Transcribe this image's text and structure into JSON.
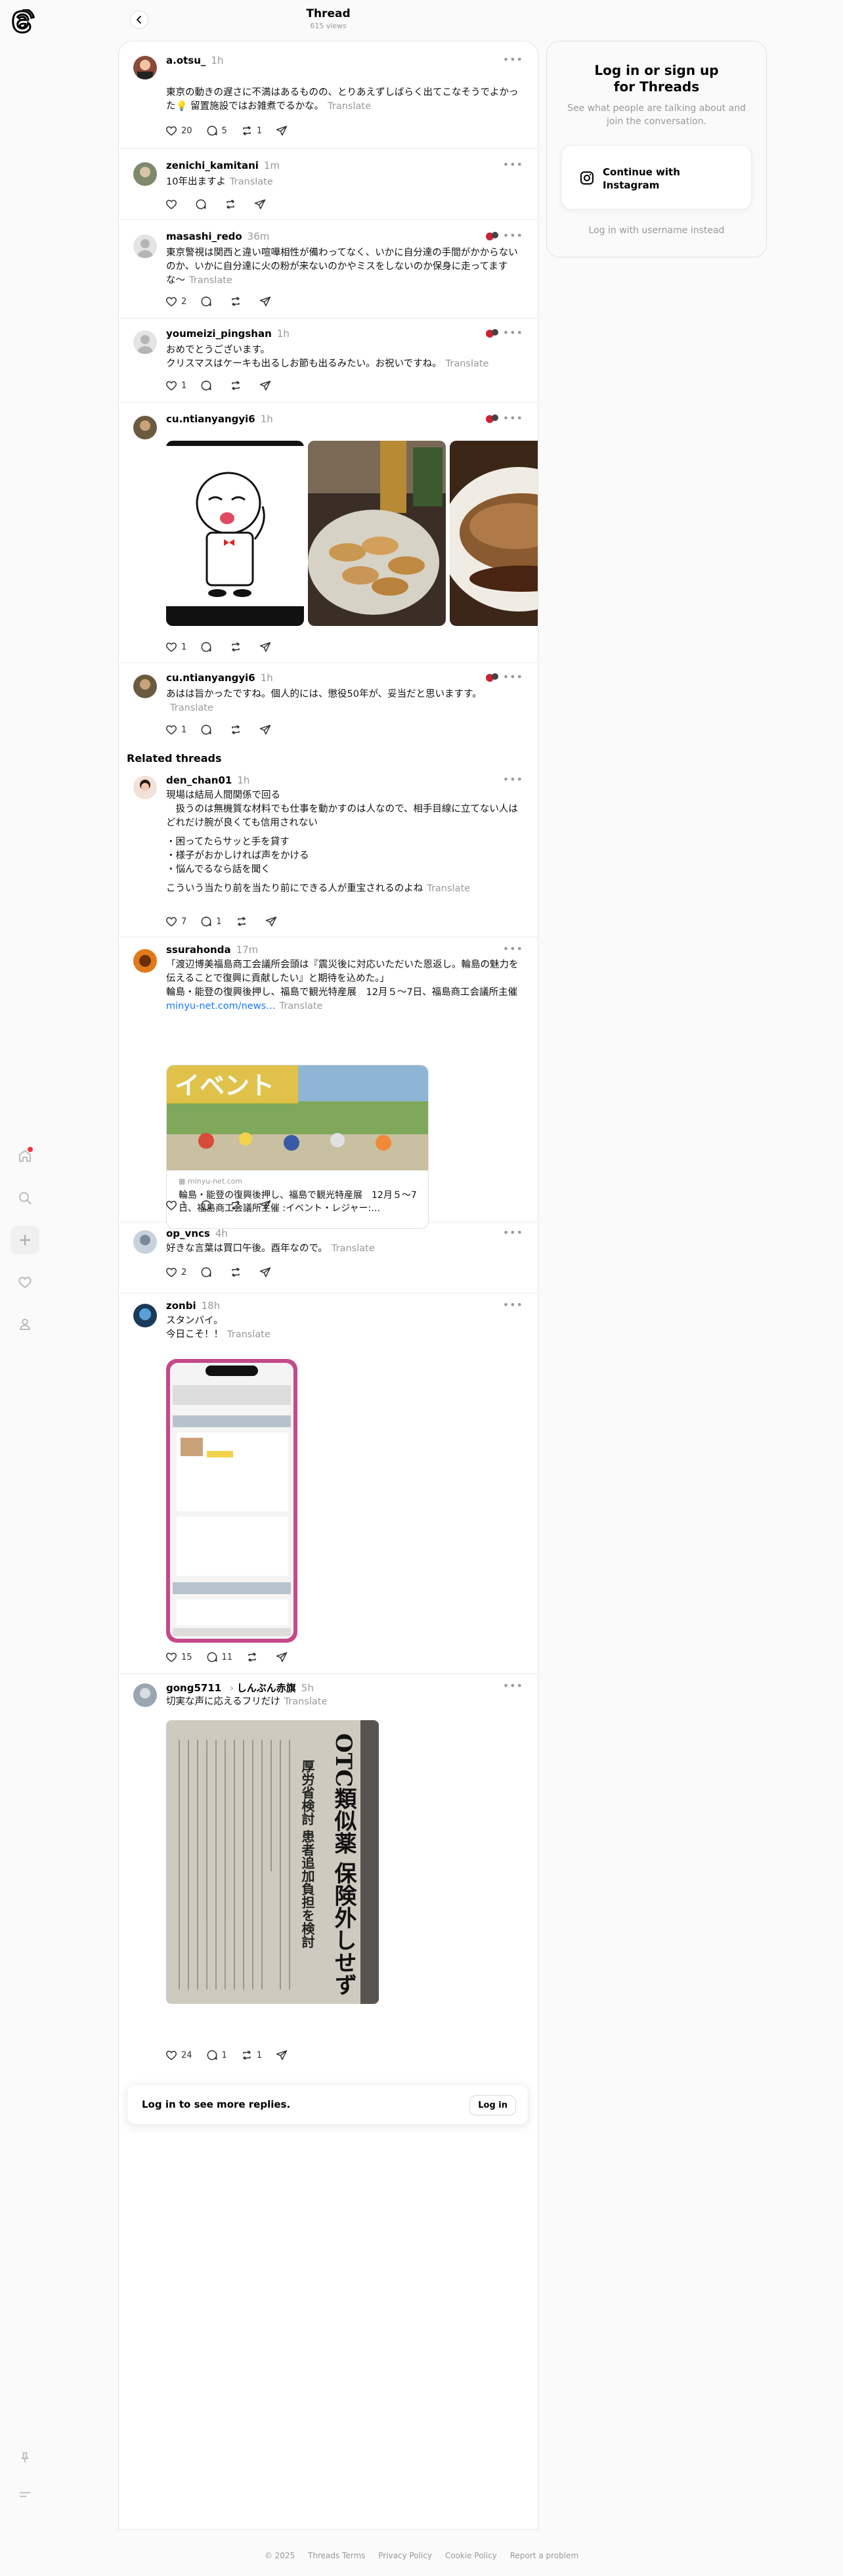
{
  "header": {
    "title": "Thread",
    "views": "615 views"
  },
  "right_panel": {
    "title": "Log in or sign up for Threads",
    "subtitle": "See what people are talking about and join the conversation.",
    "instagram_button": "Continue with Instagram",
    "username_login": "Log in with username instead"
  },
  "translate_label": "Translate",
  "related_title": "Related threads",
  "posts": [
    {
      "user": "a.otsu_",
      "time": "1h",
      "text": "東京の動きの遅さに不満はあるものの、とりあえずしばらく出てこなそうでよかった💡 留置施設ではお雑煮でるかな。",
      "likes": "20",
      "replies": "5",
      "reposts": "1"
    },
    {
      "user": "zenichi_kamitani",
      "time": "1m",
      "text": "10年出ますよ",
      "likes": "",
      "replies": "",
      "reposts": ""
    },
    {
      "user": "masashi_redo",
      "time": "36m",
      "text": "東京警視は関西と違い喧嘩相性が備わってなく、いかに自分達の手間がかからないのか、いかに自分達に火の粉が来ないのかやミスをしないのか保身に走ってますな〜",
      "likes": "2",
      "replies": "",
      "reposts": ""
    },
    {
      "user": "youmeizi_pingshan",
      "time": "1h",
      "text": "おめでとうございます。\nクリスマスはケーキも出るしお節も出るみたい。お祝いですね。",
      "likes": "1",
      "replies": "",
      "reposts": ""
    },
    {
      "user": "cu.ntianyangyi6",
      "time": "1h",
      "text": "",
      "likes": "1",
      "replies": "",
      "reposts": ""
    },
    {
      "user": "cu.ntianyangyi6",
      "time": "1h",
      "text": "あはは旨かったですね。個人的には、懲役50年が、妥当だと思いますす。",
      "likes": "1",
      "replies": "",
      "reposts": ""
    },
    {
      "user": "den_chan01",
      "time": "1h",
      "lines": [
        "現場は結局人間関係で回る",
        "現場は結局人間関係で回る",
        "　扱うのは無機質な材料でも仕事を動かすのは人なので、相手目線に立てない人はどれだけ腕が良くても信用されない",
        "・困ってたらサッと手を貸す",
        "・様子がおかしければ声をかける",
        "・悩んでるなら話を聞く",
        "こういう当たり前を当たり前にできる人が重宝されるのよね"
      ],
      "likes": "7",
      "replies": "1",
      "reposts": ""
    },
    {
      "user": "ssurahonda",
      "time": "17m",
      "text": "「渡辺博美福島商工会議所会頭は『震災後に対応いただいた恩返し。輪島の魅力を伝えることで復興に貢献したい』と期待を込めた。」\n輪島・能登の復興後押し、福島で観光特産展　12月５〜7日、福島商工会議所主催",
      "link": "minyu-net.com/news…",
      "card_label": "イベント",
      "card_domain": "minyu-net.com",
      "card_title": "輪島・能登の復興後押し、福島で観光特産展　12月５〜7日、福島商工会議所主催 :イベント・レジャー:…",
      "likes": "1",
      "replies": "",
      "reposts": ""
    },
    {
      "user": "op_vncs",
      "time": "4h",
      "text": "好きな言葉は買口午後。酉年なので。",
      "likes": "2",
      "replies": "",
      "reposts": ""
    },
    {
      "user": "zonbi",
      "time": "18h",
      "text": "スタンバイ。\n今日こそ！！",
      "likes": "15",
      "replies": "11",
      "reposts": ""
    },
    {
      "user": "gong5711",
      "time": "5h",
      "secondary": "しんぶん赤旗",
      "text": "切実な声に応えるフリだけ",
      "paper_headline": "OTC類似薬 保険外しせず",
      "paper_sub": "厚労省検討 患者追加負担を検討",
      "likes": "24",
      "replies": "1",
      "reposts": "1"
    }
  ],
  "login_bar": {
    "text": "Log in to see more replies.",
    "button": "Log in"
  },
  "footer": [
    "© 2025",
    "Threads Terms",
    "Privacy Policy",
    "Cookie Policy",
    "Report a problem"
  ],
  "colors": {
    "accent_link": "#1877f2",
    "muted": "#999999",
    "notification_dot": "#ff3040"
  }
}
